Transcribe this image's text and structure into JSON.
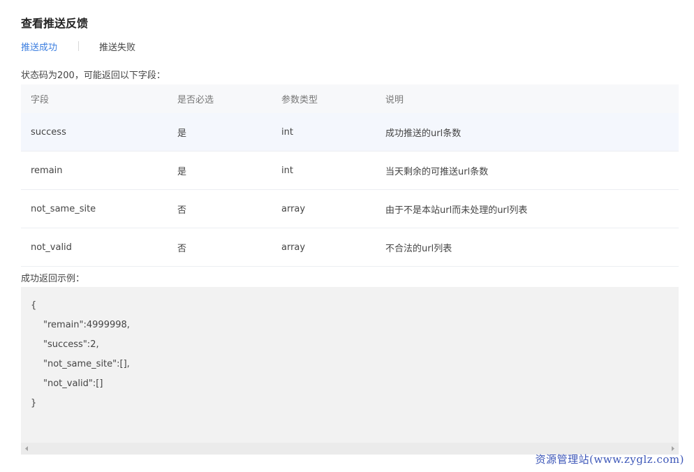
{
  "page": {
    "title": "查看推送反馈"
  },
  "tabs": [
    {
      "label": "推送成功",
      "active": true
    },
    {
      "label": "推送失败",
      "active": false
    }
  ],
  "status_text": "状态码为200，可能返回以下字段：",
  "table": {
    "headers": [
      "字段",
      "是否必选",
      "参数类型",
      "说明"
    ],
    "rows": [
      [
        "success",
        "是",
        "int",
        "成功推送的url条数"
      ],
      [
        "remain",
        "是",
        "int",
        "当天剩余的可推送url条数"
      ],
      [
        "not_same_site",
        "否",
        "array",
        "由于不是本站url而未处理的url列表"
      ],
      [
        "not_valid",
        "否",
        "array",
        "不合法的url列表"
      ]
    ]
  },
  "example_label": "成功返回示例：",
  "code_lines": [
    "{",
    "\"remain\":4999998,",
    "\"success\":2,",
    "\"not_same_site\":[],",
    "\"not_valid\":[]",
    "}"
  ],
  "watermark": "资源管理站(www.zyglz.com)",
  "colors": {
    "accent": "#3b7ee0",
    "watermark": "#3c56b8",
    "header_bg": "#f7f8fa",
    "highlight_row_bg": "#f4f7fd",
    "code_bg": "#f2f2f2"
  },
  "icons": {
    "scroll_left": "scroll-left-arrow-icon",
    "scroll_right": "scroll-right-arrow-icon"
  }
}
